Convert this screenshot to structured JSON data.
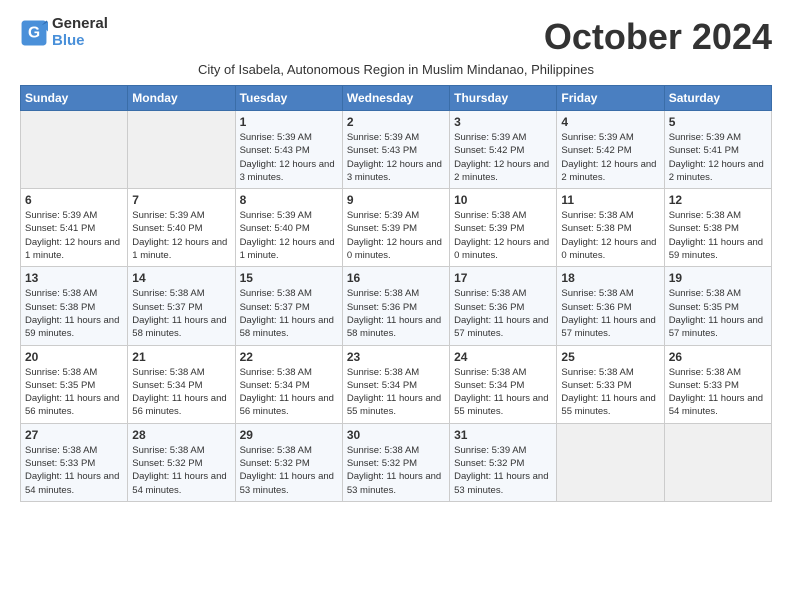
{
  "logo": {
    "line1": "General",
    "line2": "Blue"
  },
  "title": "October 2024",
  "subtitle": "City of Isabela, Autonomous Region in Muslim Mindanao, Philippines",
  "weekdays": [
    "Sunday",
    "Monday",
    "Tuesday",
    "Wednesday",
    "Thursday",
    "Friday",
    "Saturday"
  ],
  "weeks": [
    [
      {
        "day": "",
        "info": ""
      },
      {
        "day": "",
        "info": ""
      },
      {
        "day": "1",
        "info": "Sunrise: 5:39 AM\nSunset: 5:43 PM\nDaylight: 12 hours and 3 minutes."
      },
      {
        "day": "2",
        "info": "Sunrise: 5:39 AM\nSunset: 5:43 PM\nDaylight: 12 hours and 3 minutes."
      },
      {
        "day": "3",
        "info": "Sunrise: 5:39 AM\nSunset: 5:42 PM\nDaylight: 12 hours and 2 minutes."
      },
      {
        "day": "4",
        "info": "Sunrise: 5:39 AM\nSunset: 5:42 PM\nDaylight: 12 hours and 2 minutes."
      },
      {
        "day": "5",
        "info": "Sunrise: 5:39 AM\nSunset: 5:41 PM\nDaylight: 12 hours and 2 minutes."
      }
    ],
    [
      {
        "day": "6",
        "info": "Sunrise: 5:39 AM\nSunset: 5:41 PM\nDaylight: 12 hours and 1 minute."
      },
      {
        "day": "7",
        "info": "Sunrise: 5:39 AM\nSunset: 5:40 PM\nDaylight: 12 hours and 1 minute."
      },
      {
        "day": "8",
        "info": "Sunrise: 5:39 AM\nSunset: 5:40 PM\nDaylight: 12 hours and 1 minute."
      },
      {
        "day": "9",
        "info": "Sunrise: 5:39 AM\nSunset: 5:39 PM\nDaylight: 12 hours and 0 minutes."
      },
      {
        "day": "10",
        "info": "Sunrise: 5:38 AM\nSunset: 5:39 PM\nDaylight: 12 hours and 0 minutes."
      },
      {
        "day": "11",
        "info": "Sunrise: 5:38 AM\nSunset: 5:38 PM\nDaylight: 12 hours and 0 minutes."
      },
      {
        "day": "12",
        "info": "Sunrise: 5:38 AM\nSunset: 5:38 PM\nDaylight: 11 hours and 59 minutes."
      }
    ],
    [
      {
        "day": "13",
        "info": "Sunrise: 5:38 AM\nSunset: 5:38 PM\nDaylight: 11 hours and 59 minutes."
      },
      {
        "day": "14",
        "info": "Sunrise: 5:38 AM\nSunset: 5:37 PM\nDaylight: 11 hours and 58 minutes."
      },
      {
        "day": "15",
        "info": "Sunrise: 5:38 AM\nSunset: 5:37 PM\nDaylight: 11 hours and 58 minutes."
      },
      {
        "day": "16",
        "info": "Sunrise: 5:38 AM\nSunset: 5:36 PM\nDaylight: 11 hours and 58 minutes."
      },
      {
        "day": "17",
        "info": "Sunrise: 5:38 AM\nSunset: 5:36 PM\nDaylight: 11 hours and 57 minutes."
      },
      {
        "day": "18",
        "info": "Sunrise: 5:38 AM\nSunset: 5:36 PM\nDaylight: 11 hours and 57 minutes."
      },
      {
        "day": "19",
        "info": "Sunrise: 5:38 AM\nSunset: 5:35 PM\nDaylight: 11 hours and 57 minutes."
      }
    ],
    [
      {
        "day": "20",
        "info": "Sunrise: 5:38 AM\nSunset: 5:35 PM\nDaylight: 11 hours and 56 minutes."
      },
      {
        "day": "21",
        "info": "Sunrise: 5:38 AM\nSunset: 5:34 PM\nDaylight: 11 hours and 56 minutes."
      },
      {
        "day": "22",
        "info": "Sunrise: 5:38 AM\nSunset: 5:34 PM\nDaylight: 11 hours and 56 minutes."
      },
      {
        "day": "23",
        "info": "Sunrise: 5:38 AM\nSunset: 5:34 PM\nDaylight: 11 hours and 55 minutes."
      },
      {
        "day": "24",
        "info": "Sunrise: 5:38 AM\nSunset: 5:34 PM\nDaylight: 11 hours and 55 minutes."
      },
      {
        "day": "25",
        "info": "Sunrise: 5:38 AM\nSunset: 5:33 PM\nDaylight: 11 hours and 55 minutes."
      },
      {
        "day": "26",
        "info": "Sunrise: 5:38 AM\nSunset: 5:33 PM\nDaylight: 11 hours and 54 minutes."
      }
    ],
    [
      {
        "day": "27",
        "info": "Sunrise: 5:38 AM\nSunset: 5:33 PM\nDaylight: 11 hours and 54 minutes."
      },
      {
        "day": "28",
        "info": "Sunrise: 5:38 AM\nSunset: 5:32 PM\nDaylight: 11 hours and 54 minutes."
      },
      {
        "day": "29",
        "info": "Sunrise: 5:38 AM\nSunset: 5:32 PM\nDaylight: 11 hours and 53 minutes."
      },
      {
        "day": "30",
        "info": "Sunrise: 5:38 AM\nSunset: 5:32 PM\nDaylight: 11 hours and 53 minutes."
      },
      {
        "day": "31",
        "info": "Sunrise: 5:39 AM\nSunset: 5:32 PM\nDaylight: 11 hours and 53 minutes."
      },
      {
        "day": "",
        "info": ""
      },
      {
        "day": "",
        "info": ""
      }
    ]
  ]
}
